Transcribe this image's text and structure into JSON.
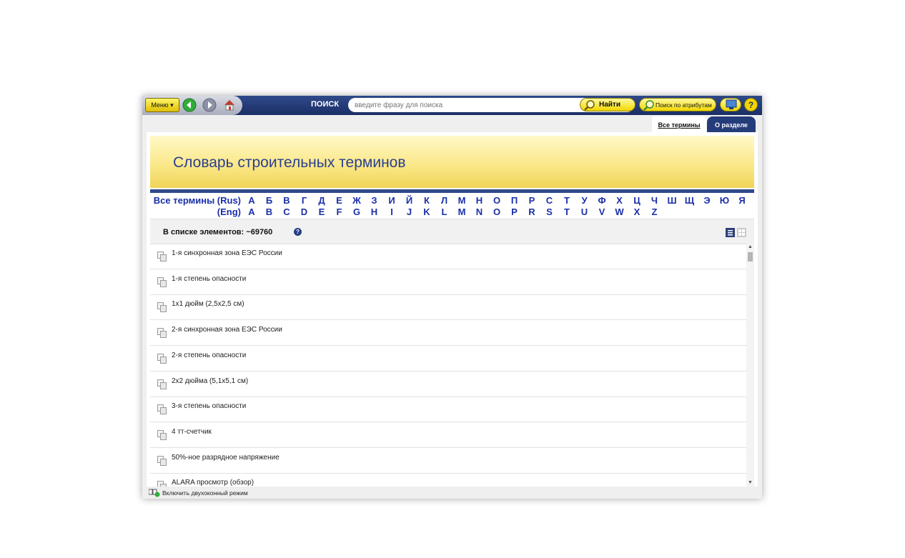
{
  "toolbar": {
    "menu_label": "Меню ▾",
    "search_label": "ПОИСК",
    "search_placeholder": "введите фразу для поиска",
    "find_label": "Найти",
    "attr_search_label": "Поиск по атрибутам"
  },
  "tabs": [
    {
      "label": "Все термины",
      "active": true
    },
    {
      "label": "О разделе",
      "active": false
    }
  ],
  "banner": {
    "title": "Словарь строительных терминов"
  },
  "alphabet": {
    "rus_label": "Все термины (Rus)",
    "eng_label": "(Eng)",
    "rus": [
      "А",
      "Б",
      "В",
      "Г",
      "Д",
      "Е",
      "Ж",
      "З",
      "И",
      "Й",
      "К",
      "Л",
      "М",
      "Н",
      "О",
      "П",
      "Р",
      "С",
      "Т",
      "У",
      "Ф",
      "Х",
      "Ц",
      "Ч",
      "Ш",
      "Щ",
      "Э",
      "Ю",
      "Я"
    ],
    "eng": [
      "A",
      "B",
      "C",
      "D",
      "E",
      "F",
      "G",
      "H",
      "I",
      "J",
      "K",
      "L",
      "M",
      "N",
      "O",
      "P",
      "R",
      "S",
      "T",
      "U",
      "V",
      "W",
      "X",
      "Z"
    ]
  },
  "list": {
    "count_text": "В списке элементов: ~69760",
    "items": [
      "1-я синхронная зона ЕЭС России",
      "1-я степень опасности",
      "1х1 дюйм (2,5х2,5 см)",
      "2-я синхронная зона ЕЭС России",
      "2-я степень опасности",
      "2х2 дюйма (5,1х5,1 см)",
      "3-я степень опасности",
      "4 тт-счетчик",
      "50%-ное разрядное напряжение",
      "ALARA просмотр (обзор)"
    ]
  },
  "status": {
    "dual_window_label": "Включить двухоконный режим"
  },
  "colors": {
    "navy": "#2f4a8a",
    "link": "#1a2fa8",
    "banner_yellow": "#fbe88a",
    "title_blue": "#2a3f8f"
  }
}
